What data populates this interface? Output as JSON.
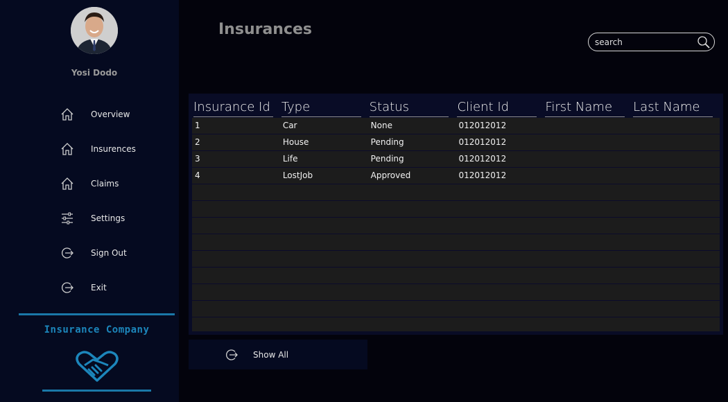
{
  "user": {
    "name": "Yosi Dodo"
  },
  "nav": [
    {
      "label": "Overview",
      "icon": "home-icon"
    },
    {
      "label": "Insurences",
      "icon": "home-icon"
    },
    {
      "label": "Claims",
      "icon": "home-icon"
    },
    {
      "label": "Settings",
      "icon": "sliders-icon"
    },
    {
      "label": "Sign Out",
      "icon": "exit-icon"
    },
    {
      "label": "Exit",
      "icon": "exit-icon"
    }
  ],
  "brand": {
    "company": "Insurance Company",
    "accent": "#1c86bb"
  },
  "page": {
    "title": "Insurances"
  },
  "search": {
    "placeholder": "search",
    "value": ""
  },
  "table": {
    "columns": [
      "Insurance Id",
      "Type",
      "Status",
      "Client Id",
      "First Name",
      "Last Name"
    ],
    "rows": [
      [
        "1",
        "Car",
        "None",
        "012012012",
        "",
        ""
      ],
      [
        "2",
        "House",
        "Pending",
        "012012012",
        "",
        ""
      ],
      [
        "3",
        "Life",
        "Pending",
        "012012012",
        "",
        ""
      ],
      [
        "4",
        "LostJob",
        "Approved",
        "012012012",
        "",
        ""
      ]
    ]
  },
  "actions": {
    "show_all": "Show All"
  }
}
